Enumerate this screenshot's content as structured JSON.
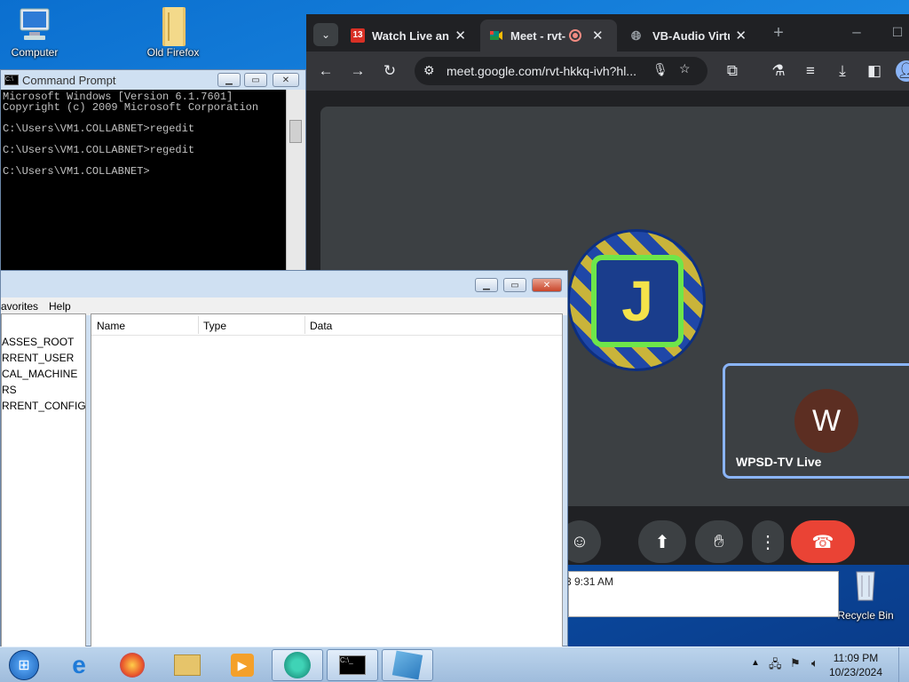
{
  "desktop": {
    "icons": [
      {
        "label": "Computer",
        "icon": "computer-icon"
      },
      {
        "label": "Old Firefox",
        "icon": "folder-icon"
      },
      {
        "label": "Recycle Bin",
        "icon": "recycle-bin-icon"
      }
    ]
  },
  "browser": {
    "tabs": [
      {
        "label": "Watch Live and",
        "icon": "channel-13-icon",
        "color": "#d93025"
      },
      {
        "label": "Meet - rvt-h",
        "icon": "google-meet-icon",
        "color": "#00897b"
      },
      {
        "label": "VB-Audio Virtu",
        "icon": "globe-icon",
        "color": "#9aa0a6"
      }
    ],
    "url": "meet.google.com/rvt-hkkq-ivh?hl...",
    "meet": {
      "participant_initial": "W",
      "participant_name": "WPSD-TV Live",
      "avatar_letter": "J",
      "end_call_color": "#ea4335"
    }
  },
  "cmd": {
    "title": "Command Prompt",
    "lines": [
      "Microsoft Windows [Version 6.1.7601]",
      "Copyright (c) 2009 Microsoft Corporation",
      "",
      "C:\\Users\\VM1.COLLABNET>regedit",
      "",
      "C:\\Users\\VM1.COLLABNET>regedit",
      "",
      "C:\\Users\\VM1.COLLABNET>"
    ]
  },
  "regedit": {
    "menu": [
      "avorites",
      "Help"
    ],
    "tree": [
      "ASSES_ROOT",
      "RRENT_USER",
      "CAL_MACHINE",
      "RS",
      "RRENT_CONFIG"
    ],
    "columns": [
      "Name",
      "Type",
      "Data"
    ]
  },
  "background_window": {
    "text": "3 9:31 AM"
  },
  "taskbar": {
    "time": "11:09 PM",
    "date": "10/23/2024"
  }
}
